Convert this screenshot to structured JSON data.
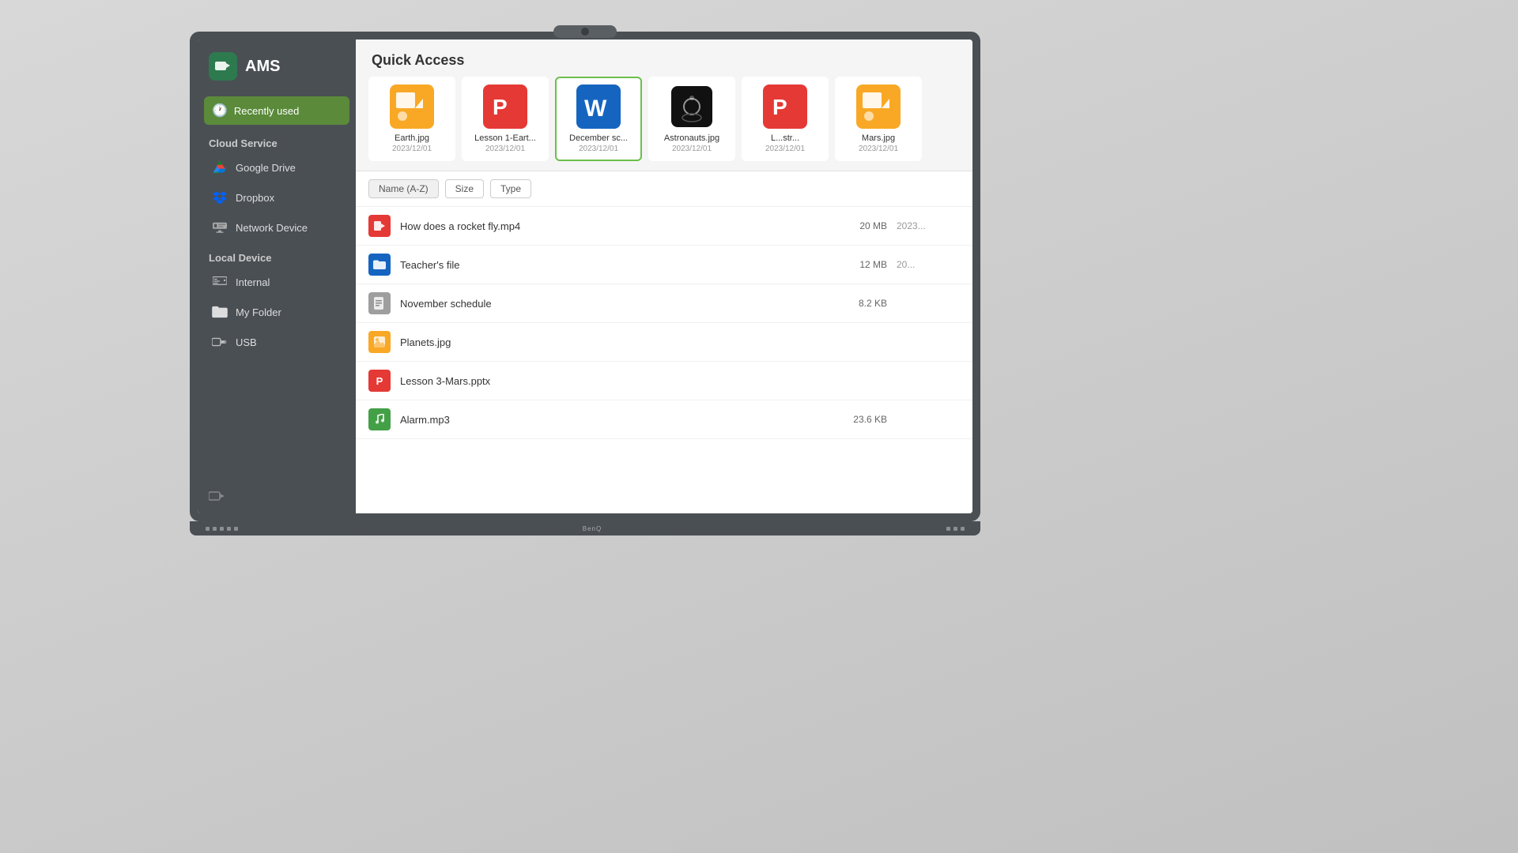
{
  "app": {
    "title": "AMS",
    "logo_char": "📁"
  },
  "sidebar": {
    "recently_used": "Recently used",
    "cloud_service": "Cloud Service",
    "local_device": "Local Device",
    "items_cloud": [
      {
        "id": "google-drive",
        "label": "Google Drive"
      },
      {
        "id": "dropbox",
        "label": "Dropbox"
      },
      {
        "id": "network-device",
        "label": "Network Device"
      }
    ],
    "items_local": [
      {
        "id": "internal",
        "label": "Internal"
      },
      {
        "id": "my-folder",
        "label": "My Folder"
      },
      {
        "id": "usb",
        "label": "USB"
      }
    ]
  },
  "quick_access": {
    "title": "Quick Access",
    "items": [
      {
        "name": "Earth.jpg",
        "date": "2023/12/01",
        "type": "jpg",
        "selected": false
      },
      {
        "name": "Lesson 1-Eart...",
        "date": "2023/12/01",
        "type": "ppt",
        "selected": false
      },
      {
        "name": "December sc...",
        "date": "2023/12/01",
        "type": "word",
        "selected": true
      },
      {
        "name": "Astronauts.jpg",
        "date": "2023/12/01",
        "type": "photo",
        "selected": false
      },
      {
        "name": "L...str...",
        "date": "2023/12/01",
        "type": "ppt2",
        "selected": false
      },
      {
        "name": "Mars.jpg",
        "date": "2023/12/01",
        "type": "jpg2",
        "selected": false
      }
    ]
  },
  "file_list": {
    "sort_options": [
      "Name (A-Z)",
      "Size",
      "Type"
    ],
    "active_sort": "Name (A-Z)",
    "files": [
      {
        "name": "How does a rocket fly.mp4",
        "size": "20 MB",
        "date": "2023...",
        "type": "video"
      },
      {
        "name": "Teacher's file",
        "size": "12 MB",
        "date": "20...",
        "type": "folder"
      },
      {
        "name": "November schedule",
        "size": "8.2 KB",
        "date": "",
        "type": "doc"
      },
      {
        "name": "Planets.jpg",
        "size": "",
        "date": "",
        "type": "image"
      },
      {
        "name": "Lesson 3-Mars.pptx",
        "size": "",
        "date": "",
        "type": "ppt"
      },
      {
        "name": "Alarm.mp3",
        "size": "23.6 KB",
        "date": "",
        "type": "music"
      }
    ]
  },
  "monitor": {
    "brand": "BenQ",
    "bottom_label": "BenQ"
  }
}
